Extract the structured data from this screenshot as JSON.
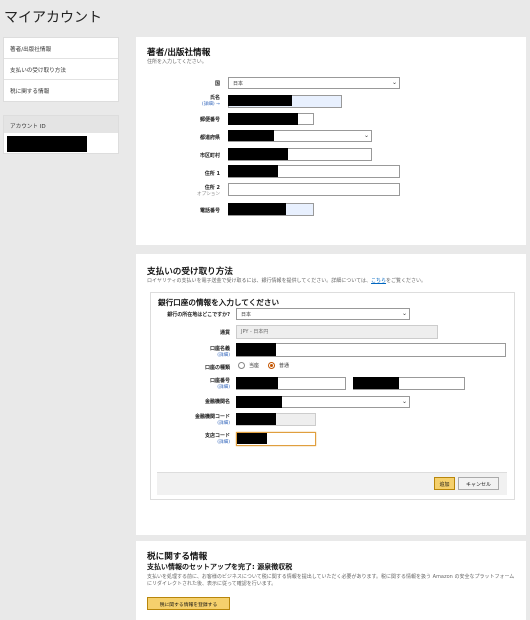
{
  "page": {
    "title": "マイアカウント"
  },
  "sidebar": {
    "items": [
      {
        "label": "著者/出版社情報"
      },
      {
        "label": "支払いの受け取り方法"
      },
      {
        "label": "税に関する情報"
      }
    ],
    "account_id_label": "アカウント ID"
  },
  "author_publisher": {
    "heading": "著者/出版社情報",
    "subtitle": "住所を入力してください。",
    "fields": {
      "country": {
        "label": "国",
        "value": "日本"
      },
      "name": {
        "label": "氏名",
        "hint": "(詳細) →"
      },
      "postal_code": {
        "label": "郵便番号"
      },
      "prefecture": {
        "label": "都道府県"
      },
      "city": {
        "label": "市区町村"
      },
      "address1": {
        "label": "住所 1"
      },
      "address2": {
        "label": "住所 2",
        "hint": "オプション"
      },
      "phone": {
        "label": "電話番号"
      }
    }
  },
  "payment": {
    "heading": "支払いの受け取り方法",
    "description": "ロイヤリティの支払いを電子送金で受け取るには、銀行情報を提供してください。詳細については、",
    "link_text": "こちら",
    "description_after": "をご覧ください。",
    "bank": {
      "heading": "銀行口座の情報を入力してください",
      "bank_location": {
        "label": "銀行の所在地はどこですか?",
        "value": "日本"
      },
      "currency": {
        "label": "通貨",
        "value": "JPY - 日本円"
      },
      "account_holder": {
        "label": "口座名義",
        "hint": "(詳細)"
      },
      "account_type": {
        "label": "口座の種類",
        "options": [
          "当座",
          "普通"
        ],
        "selected": "普通"
      },
      "account_number": {
        "label": "口座番号",
        "hint": "(詳細)"
      },
      "bank_name": {
        "label": "金融機関名"
      },
      "bank_code": {
        "label": "金融機関コード",
        "hint": "(詳細)"
      },
      "branch_code": {
        "label": "支店コード",
        "hint": "(詳細)"
      }
    },
    "add_button": "追加",
    "cancel_button": "キャンセル"
  },
  "tax": {
    "heading": "税に関する情報",
    "status": "支払い情報のセットアップを完了: 源泉徴収税",
    "description": "支払いを処理する前に、お客様のビジネスについて税に関する情報を提出していただく必要があります。税に関する情報を扱う Amazon の安全なプラットフォームにリダイレクトされた後、表示に従って確認を行います。",
    "button": "税に関する情報を登録する"
  },
  "colors": {
    "accent": "#f5d06c",
    "link": "#0066c0",
    "background": "#e9e9e9"
  }
}
